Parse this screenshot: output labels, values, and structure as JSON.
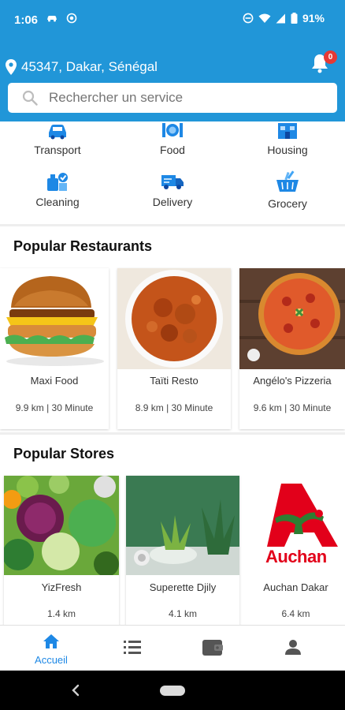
{
  "status": {
    "time": "1:06",
    "battery": "91%"
  },
  "header": {
    "location": "45347, Dakar, Sénégal",
    "notification_count": "0",
    "search_placeholder": "Rechercher un service"
  },
  "categories": [
    {
      "label": "Transport",
      "icon": "car-icon"
    },
    {
      "label": "Food",
      "icon": "food-plate-icon"
    },
    {
      "label": "Housing",
      "icon": "house-icon"
    },
    {
      "label": "Cleaning",
      "icon": "cleaning-icon"
    },
    {
      "label": "Delivery",
      "icon": "delivery-truck-icon"
    },
    {
      "label": "Grocery",
      "icon": "grocery-basket-icon"
    }
  ],
  "restaurants": {
    "title": "Popular Restaurants",
    "items": [
      {
        "name": "Maxi Food",
        "meta": "9.9 km | 30 Minute"
      },
      {
        "name": "Taïti Resto",
        "meta": "8.9 km | 30 Minute"
      },
      {
        "name": "Angélo's Pizzeria",
        "meta": "9.6 km | 30 Minute"
      }
    ]
  },
  "stores": {
    "title": "Popular Stores",
    "items": [
      {
        "name": "YizFresh",
        "meta": "1.4 km"
      },
      {
        "name": "Superette Djily",
        "meta": "4.1 km"
      },
      {
        "name": "Auchan Dakar",
        "meta": "6.4 km",
        "logo_text": "Auchan"
      }
    ]
  },
  "bottom_nav": {
    "home_label": "Accueil"
  },
  "colors": {
    "primary": "#2196d8",
    "active": "#1e88e5",
    "badge": "#e53935",
    "auchan_red": "#e2001a"
  }
}
